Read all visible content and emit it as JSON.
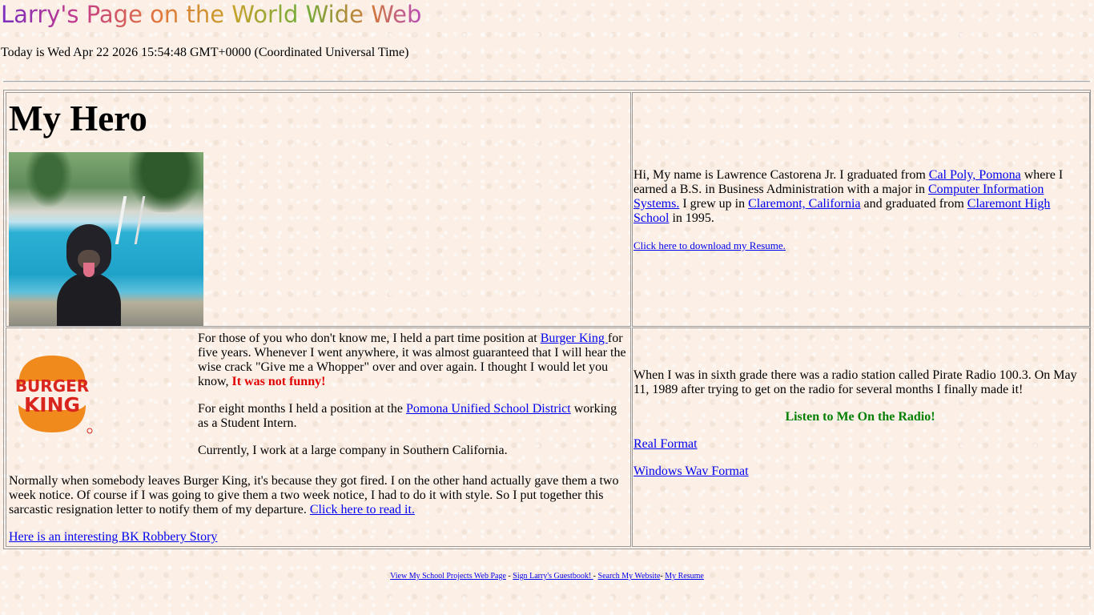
{
  "header": {
    "title": "Larry's Page on the World Wide Web",
    "today": "Today is Wed Apr 22 2026 15:54:48 GMT+0000 (Coordinated Universal Time)"
  },
  "hero": {
    "heading": "My Hero"
  },
  "intro": {
    "text_1": "Hi, My name is Lawrence Castorena Jr. I graduated from ",
    "link_calpoly": "Cal Poly, Pomona",
    "text_2": " where I earned a B.S. in Business Administration with a major in ",
    "link_cis": "Computer Information Systems.",
    "text_3": " I grew up in ",
    "link_claremont": "Claremont, California",
    "text_4": " and graduated from ",
    "link_chs": "Claremont High School",
    "text_5": " in 1995.",
    "resume_link": "Click here to download my Resume."
  },
  "burger_king": {
    "logo_word_1": "BURGER",
    "logo_word_2": "KING",
    "p1_text_1": "For those of you who don't know me, I held a part time position at ",
    "p1_link": "Burger King ",
    "p1_text_2": "for five years. Whenever I went anywhere, it was almost guaranteed that I will hear the wise crack \"Give me a Whopper\" over and over again. I thought I would let you know, ",
    "p1_red": "It was not funny!",
    "p2_text_1": "For eight months I held a position at the ",
    "p2_link": "Pomona Unified School District",
    "p2_text_2": " working as a Student Intern.",
    "p3_text": "Currently, I work at a large company in Southern California.",
    "p4_text": "Normally when somebody leaves Burger King, it's because they got fired.  I on the other hand actually gave them a two week notice.  Of course if I was going to give them a two week notice, I had to do it with style.  So I put together this sarcastic resignation letter to notify them of my departure.  ",
    "p4_link": "Click here to read it.",
    "robbery_link": "Here is an interesting BK Robbery Story"
  },
  "radio": {
    "text": "When I was in sixth grade there was a radio station called Pirate Radio 100.3. On May 11, 1989 after trying to get on the radio for several months I finally made it!",
    "heading": "Listen to Me On the Radio!",
    "link_real": "Real Format",
    "link_wav": "Windows Wav Format"
  },
  "footer": {
    "link_projects": "View My School Projects Web Page",
    "sep_1": " - ",
    "link_guestbook": "Sign Larry's Guestbook! ",
    "sep_2": "- ",
    "link_search": "Search My Website",
    "sep_3": "- ",
    "link_resume": "My Resume"
  },
  "colors": {
    "link": "#0000ee",
    "alert_red": "#e00000",
    "radio_green": "#007f00",
    "bk_orange": "#f08a1c",
    "bk_red": "#d8251d"
  }
}
